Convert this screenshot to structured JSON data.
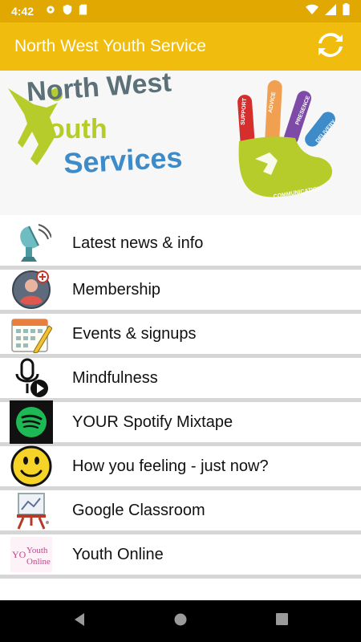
{
  "status_bar": {
    "time": "4:42"
  },
  "app_bar": {
    "title": "North West Youth Service",
    "refresh_icon": "refresh-icon"
  },
  "banner": {
    "logo_line1": "North West",
    "logo_line2": "outh",
    "logo_line3": "Services",
    "hand_fingers": [
      "SUPPORT",
      "ADVICE",
      "PRESENCE",
      "DELIVERY"
    ],
    "hand_palm": "COMMUNICATION"
  },
  "menu": [
    {
      "label": "Latest news & info",
      "icon": "satellite-dish-icon"
    },
    {
      "label": "Membership",
      "icon": "member-avatar-icon"
    },
    {
      "label": "Events & signups",
      "icon": "calendar-icon"
    },
    {
      "label": "Mindfulness",
      "icon": "mic-play-icon"
    },
    {
      "label": "YOUR Spotify Mixtape",
      "icon": "spotify-icon"
    },
    {
      "label": "How you feeling - just now?",
      "icon": "smiley-icon"
    },
    {
      "label": "Google Classroom",
      "icon": "easel-icon"
    },
    {
      "label": "Youth Online",
      "icon": "youth-online-icon",
      "icon_text_1": "Youth",
      "icon_text_2": "Online",
      "icon_text_3": "YO"
    }
  ],
  "colors": {
    "status_bar": "#e0a800",
    "app_bar": "#f0bc0e",
    "divider": "#d6d6d6"
  }
}
